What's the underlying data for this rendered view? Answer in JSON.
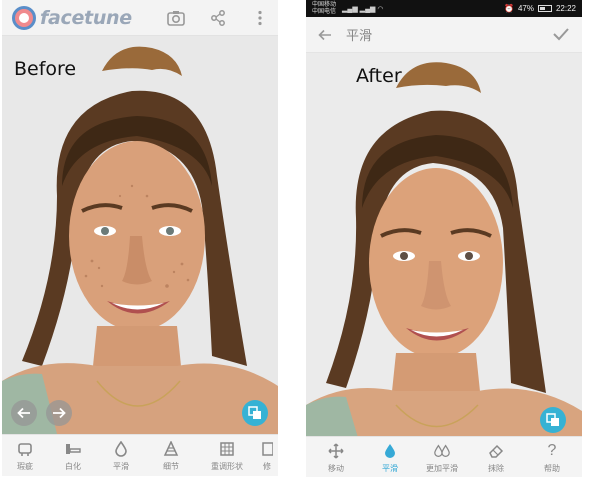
{
  "left": {
    "brand": "facetune",
    "label": "Before",
    "tools": [
      {
        "label": "瑕疵",
        "icon": "patch-icon"
      },
      {
        "label": "白化",
        "icon": "whiten-icon"
      },
      {
        "label": "平滑",
        "icon": "smooth-drop-icon"
      },
      {
        "label": "细节",
        "icon": "details-icon"
      },
      {
        "label": "重调形状",
        "icon": "reshape-icon"
      },
      {
        "label": "修",
        "icon": "retouch-icon"
      }
    ]
  },
  "right": {
    "status": {
      "carrier1": "中国移动",
      "carrier2": "中国电信",
      "battery": "47%",
      "time": "22:22"
    },
    "title": "平滑",
    "label": "After",
    "tools": [
      {
        "label": "移动",
        "icon": "move-icon"
      },
      {
        "label": "平滑",
        "icon": "smooth-drop-icon",
        "active": true
      },
      {
        "label": "更加平滑",
        "icon": "smoother-icon"
      },
      {
        "label": "抹除",
        "icon": "eraser-icon"
      },
      {
        "label": "帮助",
        "icon": "help-icon"
      }
    ]
  },
  "colors": {
    "accent": "#36b2d4",
    "toolbar_bg": "#f4f4f4",
    "photo_bg": "#e9e9e9"
  }
}
